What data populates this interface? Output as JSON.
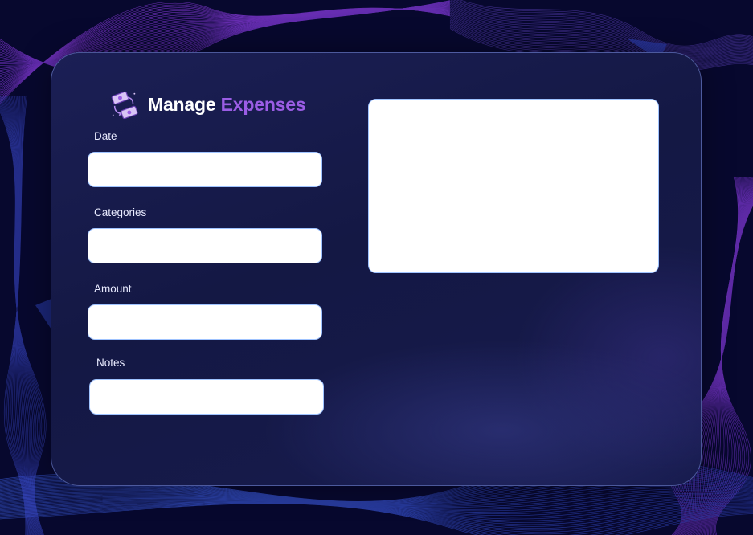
{
  "colors": {
    "background": "#07082e",
    "panel": "#161a4c",
    "title_primary": "#ffffff",
    "title_accent": "#9b5de5",
    "input_border": "#9fc3ff"
  },
  "header": {
    "icon": "money-transfer-icon",
    "title_main": "Manage",
    "title_accent": "Expenses"
  },
  "form": {
    "date": {
      "label": "Date",
      "value": ""
    },
    "categories": {
      "label": "Categories",
      "value": ""
    },
    "amount": {
      "label": "Amount",
      "value": ""
    },
    "notes": {
      "label": "Notes",
      "value": ""
    }
  },
  "preview": {
    "icon": "blank-panel"
  }
}
